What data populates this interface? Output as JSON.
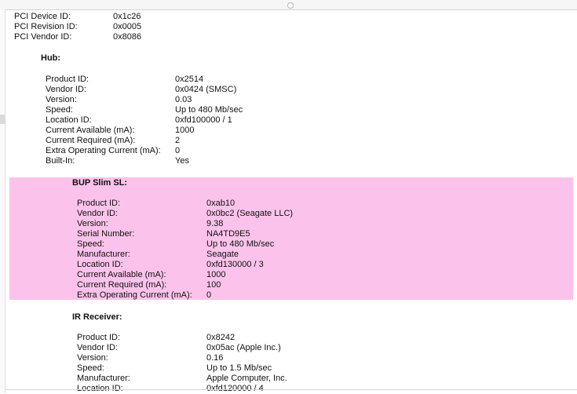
{
  "top": [
    {
      "k": "PCI Device ID:",
      "v": "0x1c26"
    },
    {
      "k": "PCI Revision ID:",
      "v": "0x0005"
    },
    {
      "k": "PCI Vendor ID:",
      "v": "0x8086"
    }
  ],
  "hub": {
    "title": "Hub:",
    "rows": [
      {
        "k": "Product ID:",
        "v": "0x2514"
      },
      {
        "k": "Vendor ID:",
        "v": "0x0424  (SMSC)"
      },
      {
        "k": "Version:",
        "v": "0.03"
      },
      {
        "k": "Speed:",
        "v": "Up to 480 Mb/sec"
      },
      {
        "k": "Location ID:",
        "v": "0xfd100000 / 1"
      },
      {
        "k": "Current Available (mA):",
        "v": "1000"
      },
      {
        "k": "Current Required (mA):",
        "v": "2"
      },
      {
        "k": "Extra Operating Current (mA):",
        "v": "0"
      },
      {
        "k": "Built-In:",
        "v": "Yes"
      }
    ]
  },
  "bup": {
    "title": "BUP Slim SL:",
    "highlight_color": "#fbc3eb",
    "rows": [
      {
        "k": "Product ID:",
        "v": "0xab10"
      },
      {
        "k": "Vendor ID:",
        "v": "0x0bc2  (Seagate LLC)"
      },
      {
        "k": "Version:",
        "v": "9.38"
      },
      {
        "k": "Serial Number:",
        "v": "NA4TD9E5"
      },
      {
        "k": "Speed:",
        "v": "Up to 480 Mb/sec"
      },
      {
        "k": "Manufacturer:",
        "v": "Seagate"
      },
      {
        "k": "Location ID:",
        "v": "0xfd130000 / 3"
      },
      {
        "k": "Current Available (mA):",
        "v": "1000"
      },
      {
        "k": "Current Required (mA):",
        "v": "100"
      },
      {
        "k": "Extra Operating Current (mA):",
        "v": "0"
      }
    ]
  },
  "ir": {
    "title": "IR Receiver:",
    "rows": [
      {
        "k": "Product ID:",
        "v": "0x8242"
      },
      {
        "k": "Vendor ID:",
        "v": "0x05ac  (Apple Inc.)"
      },
      {
        "k": "Version:",
        "v": "0.16"
      },
      {
        "k": "Speed:",
        "v": "Up to 1.5 Mb/sec"
      },
      {
        "k": "Manufacturer:",
        "v": "Apple Computer, Inc."
      },
      {
        "k": "Location ID:",
        "v": "0xfd120000 / 4"
      }
    ]
  }
}
